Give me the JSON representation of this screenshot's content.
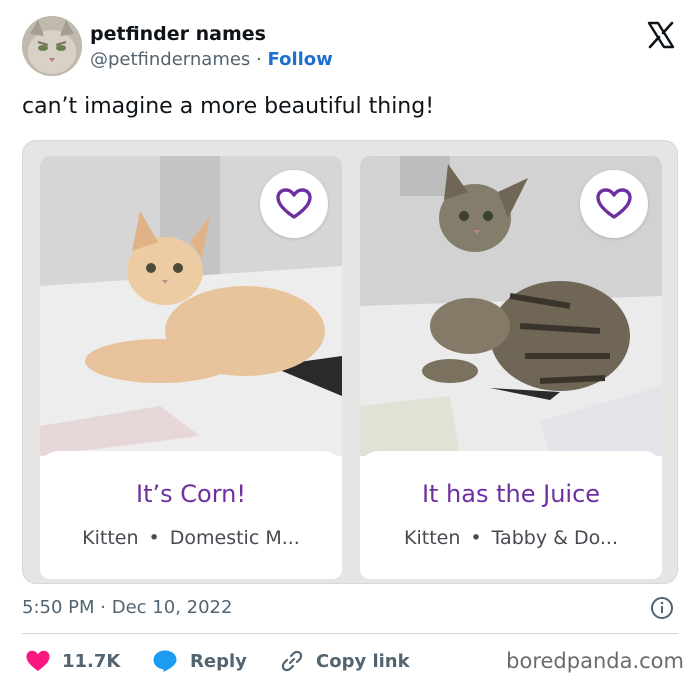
{
  "author": {
    "display_name": "petfinder names",
    "handle": "@petfindernames",
    "separator": "·",
    "follow_label": "Follow"
  },
  "tweet": {
    "text": "can’t imagine a more beautiful thing!",
    "time": "5:50 PM",
    "date_separator": "·",
    "date": "Dec 10, 2022"
  },
  "cards": [
    {
      "name": "It’s Corn!",
      "age": "Kitten",
      "bullet": "•",
      "breed": "Domestic M..."
    },
    {
      "name": "It has the Juice",
      "age": "Kitten",
      "bullet": "•",
      "breed": "Tabby & Do..."
    }
  ],
  "actions": {
    "likes": "11.7K",
    "reply_label": "Reply",
    "copy_label": "Copy link"
  },
  "watermark": "boredpanda.com",
  "colors": {
    "heart_like": "#f91880",
    "reply_bubble": "#1d9bf0",
    "follow": "#1d6fd0",
    "card_title": "#6e2fa0",
    "heart_outline": "#6e2fa0"
  },
  "icons": [
    "x-logo-icon",
    "heart-outline-icon",
    "info-icon",
    "heart-icon",
    "reply-icon",
    "link-icon"
  ]
}
